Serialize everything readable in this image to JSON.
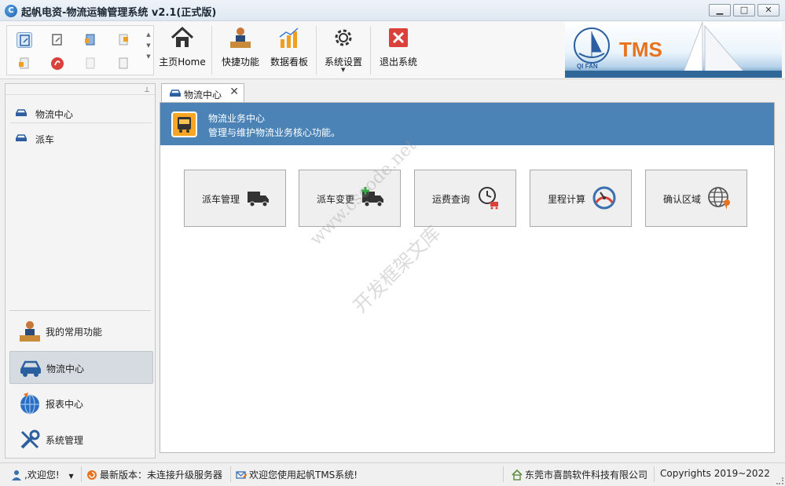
{
  "window": {
    "title": "起帆电资-物流运输管理系统 v2.1(正式版)",
    "minimize": "▁",
    "maximize": "□",
    "close": "✕"
  },
  "toolbar": {
    "buttons": [
      {
        "label": "主页Home",
        "icon": "home-icon"
      },
      {
        "label": "快捷功能",
        "icon": "person-desk-icon"
      },
      {
        "label": "数据看板",
        "icon": "bar-chart-icon"
      },
      {
        "label": "系统设置",
        "icon": "gear-icon"
      },
      {
        "label": "退出系统",
        "icon": "exit-icon"
      }
    ],
    "banner": {
      "brand_text": "TMS",
      "logo_text": "QI FAN"
    }
  },
  "sidebar": {
    "items": [
      {
        "label": "物流中心",
        "icon": "car-icon"
      },
      {
        "label": "派车",
        "icon": "car-icon"
      }
    ],
    "bottom": [
      {
        "label": "我的常用功能",
        "icon": "person-desk-icon"
      },
      {
        "label": "物流中心",
        "icon": "car-icon",
        "active": true
      },
      {
        "label": "报表中心",
        "icon": "globe-icon"
      },
      {
        "label": "系统管理",
        "icon": "tools-icon"
      }
    ]
  },
  "tab": {
    "label": "物流中心",
    "close": "✕"
  },
  "content": {
    "title": "物流业务中心",
    "description": "管理与维护物流业务核心功能。",
    "buttons": [
      {
        "label": "派车管理",
        "icon": "truck-icon"
      },
      {
        "label": "派车变更",
        "icon": "truck-add-icon"
      },
      {
        "label": "运费查询",
        "icon": "clock-cart-icon"
      },
      {
        "label": "里程计算",
        "icon": "speedometer-icon"
      },
      {
        "label": "确认区域",
        "icon": "globe-pin-icon"
      }
    ],
    "watermark": "www.cscode.net",
    "watermark2": "开发框架文库"
  },
  "status": {
    "user": ",欢迎您!",
    "version": "最新版本：未连接升级服务器",
    "welcome": "欢迎您使用起帆TMS系统!",
    "company": "东莞市喜鹊软件科技有限公司",
    "copyright": "Copyrights 2019~2022"
  },
  "colors": {
    "accent": "#4b83b6",
    "exit_red": "#d9413a",
    "tms_orange": "#e8731e"
  }
}
